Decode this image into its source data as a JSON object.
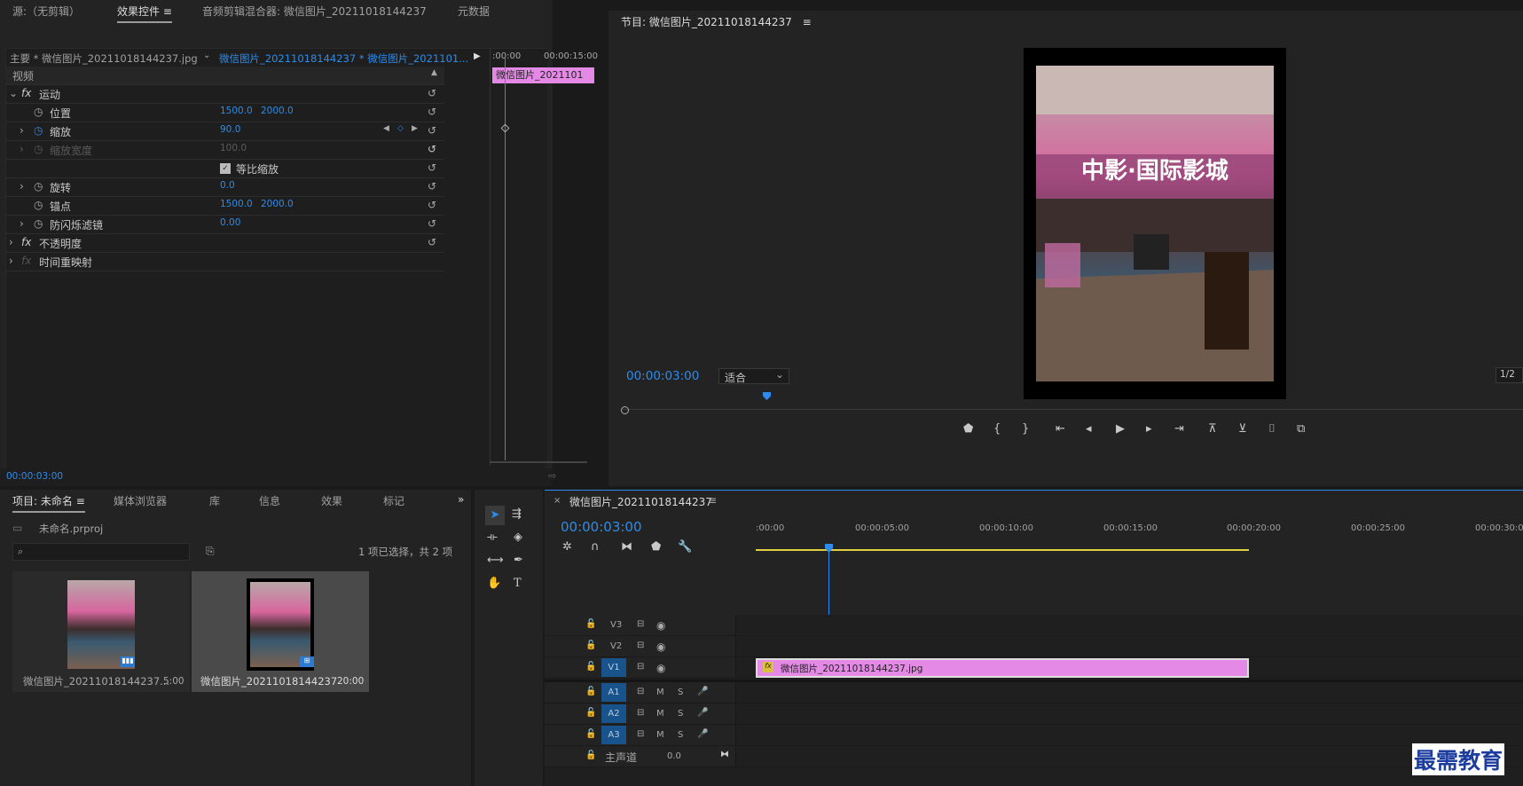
{
  "top_tabs": {
    "source": "源:（无剪辑）",
    "effect_controls": "效果控件",
    "audio_mixer": "音频剪辑混合器: 微信图片_20211018144237",
    "metadata": "元数据"
  },
  "effect_controls": {
    "master": "主要 * 微信图片_20211018144237.jpg",
    "sequence": "微信图片_20211018144237 * 微信图片_2021101...",
    "ruler_start": ":00:00",
    "ruler_end": "00:00:15:00",
    "clip_label": "微信图片_2021101",
    "section_video": "视频",
    "fx": "fx",
    "motion": "运动",
    "position": {
      "label": "位置",
      "x": "1500.0",
      "y": "2000.0"
    },
    "scale": {
      "label": "缩放",
      "value": "90.0"
    },
    "scale_width": {
      "label": "缩放宽度",
      "value": "100.0"
    },
    "uniform": "等比缩放",
    "rotation": {
      "label": "旋转",
      "value": "0.0"
    },
    "anchor": {
      "label": "锚点",
      "x": "1500.0",
      "y": "2000.0"
    },
    "flicker": {
      "label": "防闪烁滤镜",
      "value": "0.00"
    },
    "opacity": "不透明度",
    "time_remap": "时间重映射",
    "timecode": "00:00:03:00"
  },
  "program": {
    "title": "节目: 微信图片_20211018144237",
    "timecode": "00:00:03:00",
    "fit": "适合",
    "ratio": "1/2",
    "image_text": "中影·国际影城"
  },
  "project": {
    "tabs": [
      "项目: 未命名",
      "媒体浏览器",
      "库",
      "信息",
      "效果",
      "标记"
    ],
    "file": "未命名.prproj",
    "selection": "1 项已选择，共 2 项",
    "items": [
      {
        "name": "微信图片_20211018144237...",
        "dur": "5:00"
      },
      {
        "name": "微信图片_20211018144237",
        "dur": "20:00"
      }
    ]
  },
  "timeline": {
    "title": "微信图片_20211018144237",
    "timecode": "00:00:03:00",
    "ticks": [
      ":00:00",
      "00:00:05:00",
      "00:00:10:00",
      "00:00:15:00",
      "00:00:20:00",
      "00:00:25:00",
      "00:00:30:00"
    ],
    "tracks_v": [
      "V3",
      "V2",
      "V1"
    ],
    "tracks_a": [
      "A1",
      "A2",
      "A3"
    ],
    "master": "主声道",
    "master_val": "0.0",
    "clip": "微信图片_20211018144237.jpg",
    "m": "M",
    "s": "S"
  },
  "watermark": "最需教育"
}
